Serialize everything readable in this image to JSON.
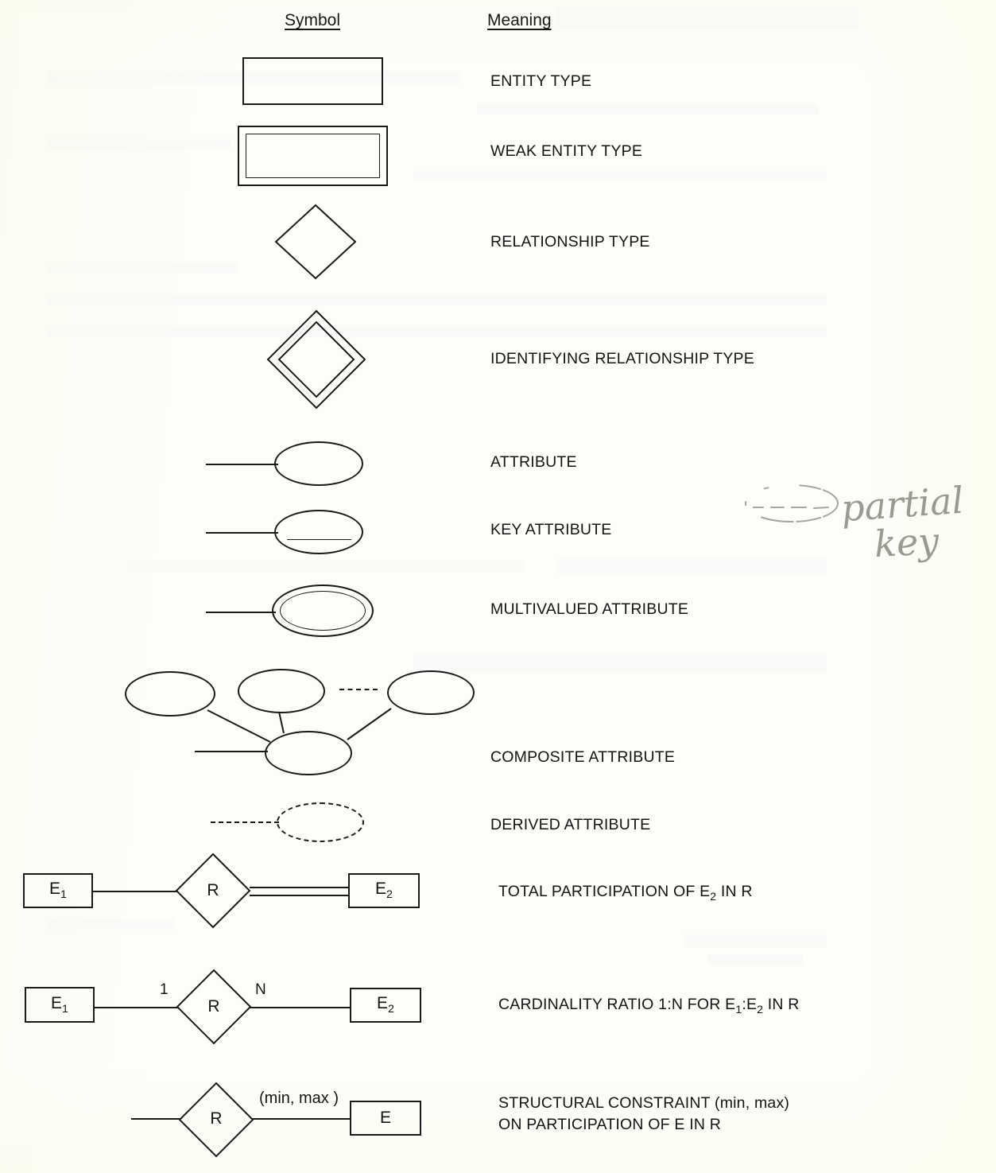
{
  "page": {
    "background_color": "#fdfdfa",
    "ink_color": "#1a1a1a",
    "pencil_color": "#a6a69e"
  },
  "headers": {
    "symbol": "Symbol",
    "meaning": "Meaning"
  },
  "rows": [
    {
      "symbol": "rectangle",
      "meaning": "ENTITY TYPE"
    },
    {
      "symbol": "double-rectangle",
      "meaning": "WEAK ENTITY TYPE"
    },
    {
      "symbol": "diamond",
      "meaning": "RELATIONSHIP TYPE"
    },
    {
      "symbol": "double-diamond",
      "meaning": "IDENTIFYING RELATIONSHIP TYPE"
    },
    {
      "symbol": "ellipse-with-line",
      "meaning": "ATTRIBUTE"
    },
    {
      "symbol": "ellipse-underlined",
      "meaning": "KEY ATTRIBUTE"
    },
    {
      "symbol": "double-ellipse",
      "meaning": "MULTIVALUED ATTRIBUTE"
    },
    {
      "symbol": "composite-ellipse-tree",
      "meaning": "COMPOSITE ATTRIBUTE"
    },
    {
      "symbol": "dashed-ellipse",
      "meaning": "DERIVED ATTRIBUTE"
    },
    {
      "symbol": "total-participation-diagram",
      "meaning": "TOTAL PARTICIPATION OF E2 IN R"
    },
    {
      "symbol": "cardinality-ratio-diagram",
      "meaning": "CARDINALITY RATIO 1:N FOR E1:E2 IN R"
    },
    {
      "symbol": "structural-constraint-diagram",
      "meaning": "STRUCTURAL CONSTRAINT (min, max)\nON PARTICIPATION OF E IN R"
    }
  ],
  "diagrams": {
    "total_participation": {
      "left_entity": "E1",
      "left_entity_base": "E",
      "left_entity_sub": "1",
      "relationship": "R",
      "right_entity_base": "E",
      "right_entity_sub": "2",
      "left_line": "single",
      "right_line": "double"
    },
    "cardinality": {
      "left_entity_base": "E",
      "left_entity_sub": "1",
      "relationship": "R",
      "right_entity_base": "E",
      "right_entity_sub": "2",
      "left_cardinality": "1",
      "right_cardinality": "N"
    },
    "structural_constraint": {
      "relationship": "R",
      "entity": "E",
      "constraint_label": "(min, max )"
    }
  },
  "annotation": {
    "text_line1": "partial",
    "text_line2": "key",
    "symbol": "ellipse-with-dashed-underline"
  }
}
